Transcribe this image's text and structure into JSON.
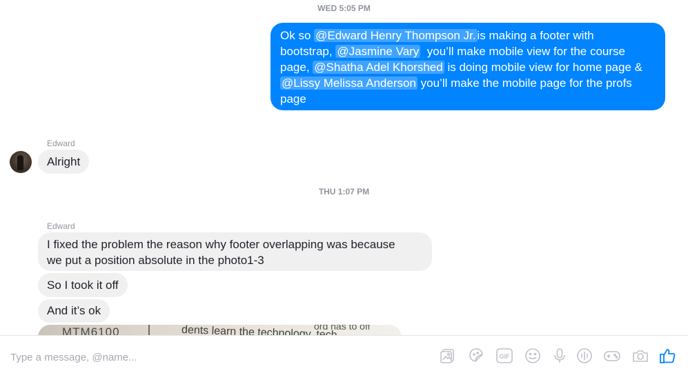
{
  "timestamps": {
    "first": "WED 5:05 PM",
    "second": "THU 1:07 PM"
  },
  "outgoing": {
    "line1_pre": "Ok so ",
    "mention1": "@Edward Henry Thompson Jr.",
    "line1_post": "is making a footer with",
    "line2_pre": "bootstrap, ",
    "mention2": "@Jasmine Vary",
    "line2_post": "  you’ll make mobile view for the course",
    "line3_pre": "page, ",
    "mention3": "@Shatha Adel Khorshed",
    "line3_post": " is doing mobile view for home page &",
    "mention4": "@Lissy Melissa Anderson",
    "line4_post": " you’ll make the mobile page for the profs",
    "line5": "page"
  },
  "incoming": {
    "sender1": "Edward",
    "msg1": "Alright",
    "sender2": "Edward",
    "msg2_line1": "I fixed the problem the reason why footer overlapping was because",
    "msg2_line2": "we put a position absolute in the photo1-3",
    "msg3": "So I took it off",
    "msg4": "And it’s ok"
  },
  "photo": {
    "text1": "MTM6100",
    "text2": "dents learn the technology, tech",
    "text3": "ord has to off"
  },
  "composer": {
    "placeholder": "Type a message, @name...",
    "gif_label": "GIF",
    "accent_color": "#0084ff",
    "icons": [
      "image-icon",
      "sticker-icon",
      "gif-icon",
      "emoji-icon",
      "microphone-icon",
      "audio-icon",
      "game-icon",
      "camera-icon",
      "thumbs-up-icon"
    ]
  }
}
